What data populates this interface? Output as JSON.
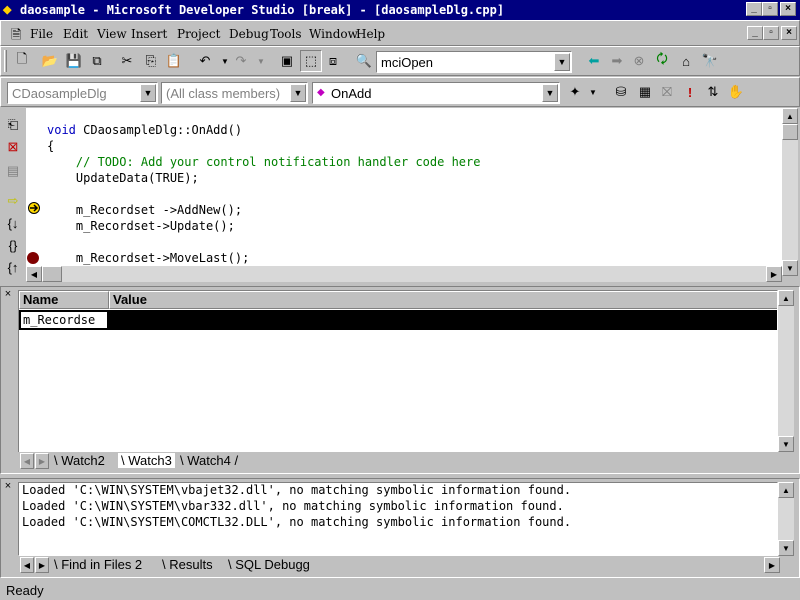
{
  "window": {
    "title": "daosample - Microsoft Developer Studio [break] - [daosampleDlg.cpp]",
    "title_bar_color": "#000080"
  },
  "menu": {
    "items": [
      "File",
      "Edit",
      "View",
      "Insert",
      "Project",
      "Debug",
      "Tools",
      "Window",
      "Help"
    ]
  },
  "toolbar1": {
    "find_combo_value": "mciOpen",
    "icons": [
      "new-file-icon",
      "open-folder-icon",
      "save-icon",
      "save-all-icon",
      "cut-icon",
      "copy-icon",
      "paste-icon",
      "undo-icon",
      "redo-icon",
      "workspace-icon",
      "output-icon",
      "window-list-icon",
      "find-in-files-icon",
      "back-icon",
      "forward-icon",
      "stop-icon",
      "bookmark-icon",
      "home-icon",
      "search-help-icon"
    ]
  },
  "toolbar2": {
    "class_combo": "CDaosampleDlg",
    "filter_combo": "(All class members)",
    "member_combo": "OnAdd",
    "icons": [
      "wizard-icon",
      "compile-icon",
      "build-icon",
      "stop-build-icon",
      "go-icon",
      "insert-breakpoint-icon",
      "remove-breakpoints-icon"
    ]
  },
  "editor": {
    "lines": [
      {
        "keyword": "void",
        "text": " CDaosampleDlg::OnAdd()"
      },
      {
        "keyword": "",
        "text": "{"
      },
      {
        "comment": "    // TODO: Add your control notification handler code here"
      },
      {
        "keyword": "",
        "text": "    UpdateData(TRUE);"
      },
      {
        "keyword": "",
        "text": ""
      },
      {
        "keyword": "",
        "text": "    m_Recordset ->AddNew();"
      },
      {
        "keyword": "",
        "text": "    m_Recordset->Update();"
      },
      {
        "keyword": "",
        "text": ""
      },
      {
        "keyword": "",
        "text": "    m_Recordset->MoveLast();"
      }
    ]
  },
  "watch": {
    "col_name": "Name",
    "col_value": "Value",
    "row_name": "m_Recordse",
    "row_value": "",
    "tabs": [
      "Watch2",
      "Watch3",
      "Watch4"
    ]
  },
  "output": {
    "lines": [
      "Loaded 'C:\\WIN\\SYSTEM\\vbajet32.dll', no matching symbolic information found.",
      "Loaded 'C:\\WIN\\SYSTEM\\vbar332.dll', no matching symbolic information found.",
      "Loaded 'C:\\WIN\\SYSTEM\\COMCTL32.DLL', no matching symbolic information found."
    ],
    "tabs": [
      "Find in Files 2",
      "Results",
      "SQL Debugg"
    ]
  },
  "status": {
    "text": "Ready"
  }
}
